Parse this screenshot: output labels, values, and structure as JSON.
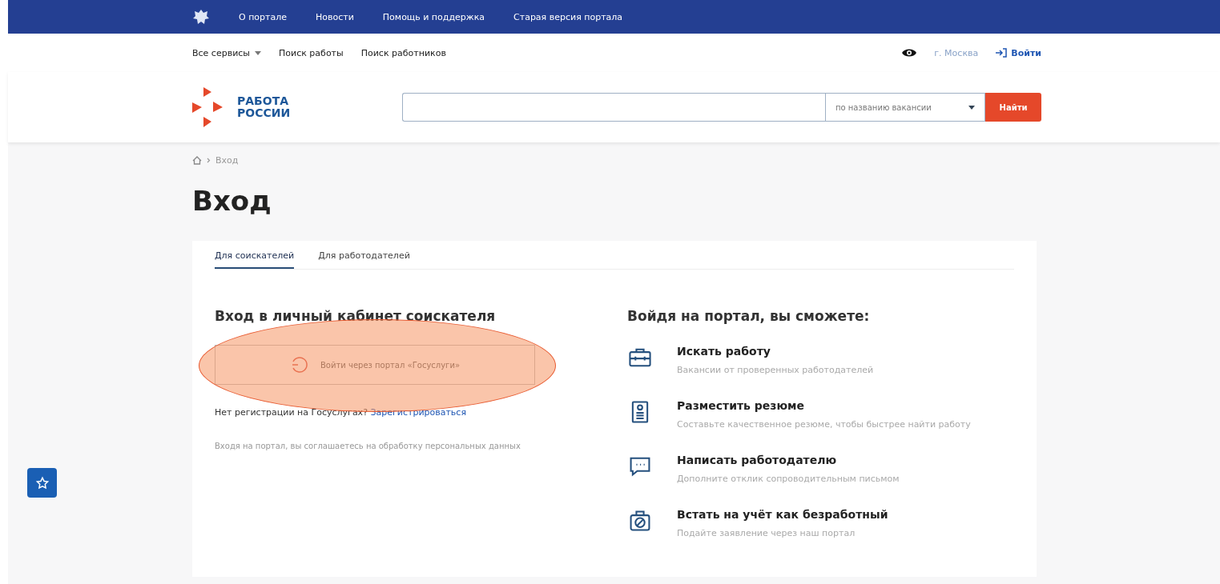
{
  "top_nav": {
    "links": [
      "О портале",
      "Новости",
      "Помощь и поддержка",
      "Старая версия портала"
    ]
  },
  "sub_nav": {
    "services": "Все сервисы",
    "links": [
      "Поиск работы",
      "Поиск работников"
    ],
    "city": "г. Москва",
    "login": "Войти"
  },
  "header": {
    "logo": [
      "РАБОТА",
      "РОССИИ"
    ],
    "search": {
      "mode": "по названию вакансии",
      "button": "Найти"
    }
  },
  "breadcrumb": [
    "Вход"
  ],
  "page_title": "Вход",
  "tabs": [
    {
      "label": "Для соискателей",
      "selected": true
    },
    {
      "label": "Для работодателей",
      "selected": false
    }
  ],
  "login": {
    "title": "Вход в личный кабинет соискателя",
    "gosuslugi_button": "Войти через портал «Госуслуги»",
    "highlighted": true,
    "no_account": "Нет регистрации на Госуслугах?",
    "register_link": "Зарегистрироваться",
    "consent": "Входя на портал, вы соглашаетесь на обработку персональных данных"
  },
  "features": {
    "title": "Войдя на портал, вы сможете:",
    "items": [
      {
        "kind": "briefcase",
        "title": "Искать работу",
        "text": "Вакансии от проверенных работодателей"
      },
      {
        "kind": "resume",
        "title": "Разместить резюме",
        "text": "Составьте качественное резюме, чтобы быстрее найти работу"
      },
      {
        "kind": "chat",
        "title": "Написать работодателю",
        "text": "Дополните отклик сопроводительным письмом"
      },
      {
        "kind": "register",
        "title": "Встать на учёт как безработный",
        "text": "Подайте заявление через наш портал"
      }
    ]
  }
}
